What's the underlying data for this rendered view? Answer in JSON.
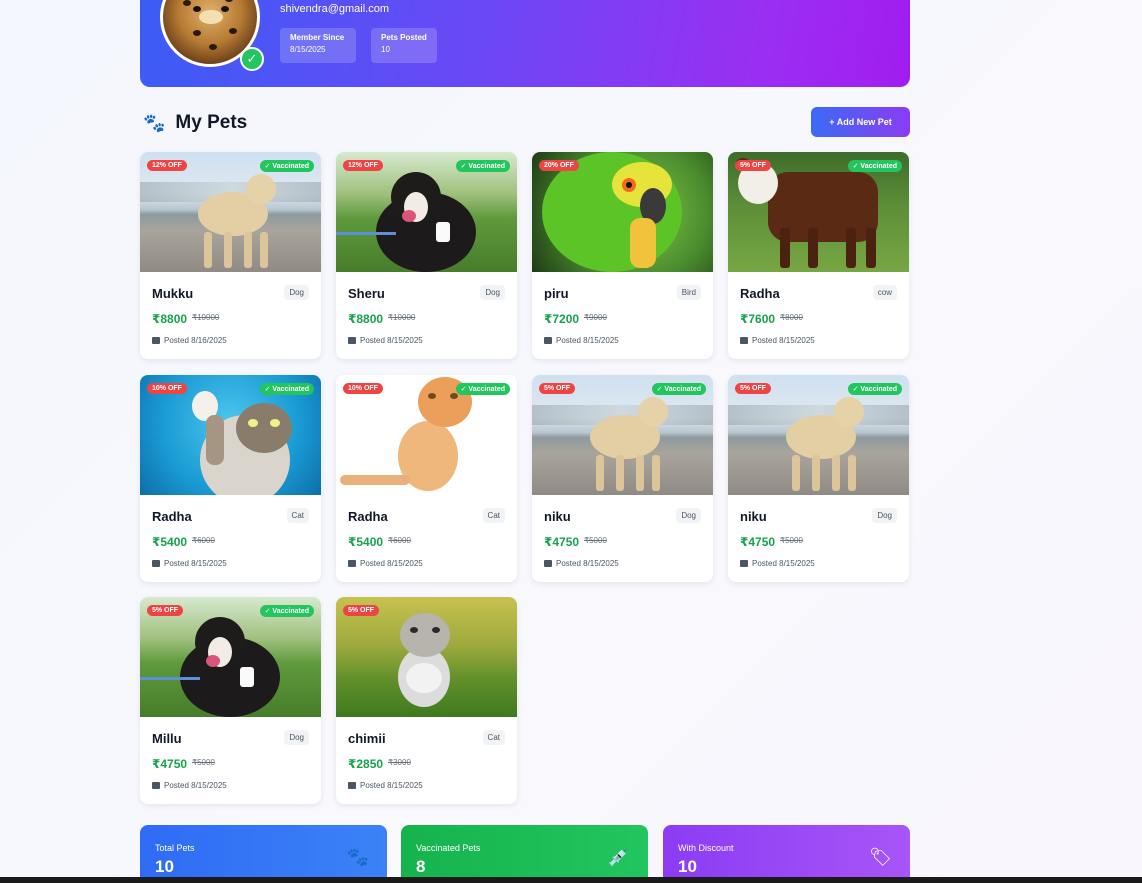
{
  "profile": {
    "email": "shivendra@gmail.com",
    "member_since_label": "Member Since",
    "member_since_value": "8/15/2025",
    "pets_posted_label": "Pets Posted",
    "pets_posted_value": "10"
  },
  "section": {
    "title": "My Pets",
    "add_button": "+ Add New Pet"
  },
  "pets": [
    {
      "name": "Mukku",
      "type": "Dog",
      "discount": "12% OFF",
      "vaccinated": "✓ Vaccinated",
      "price": "₹8800",
      "old_price": "₹10000",
      "posted": "Posted 8/16/2025",
      "scene": "beach-dog"
    },
    {
      "name": "Sheru",
      "type": "Dog",
      "discount": "12% OFF",
      "vaccinated": "✓ Vaccinated",
      "price": "₹8800",
      "old_price": "₹10000",
      "posted": "Posted 8/15/2025",
      "scene": "bernese"
    },
    {
      "name": "piru",
      "type": "Bird",
      "discount": "20% OFF",
      "vaccinated": "",
      "price": "₹7200",
      "old_price": "₹9000",
      "posted": "Posted 8/15/2025",
      "scene": "parrot"
    },
    {
      "name": "Radha",
      "type": "cow",
      "discount": "5% OFF",
      "vaccinated": "✓ Vaccinated",
      "price": "₹7600",
      "old_price": "₹8000",
      "posted": "Posted 8/15/2025",
      "scene": "cow"
    },
    {
      "name": "Radha",
      "type": "Cat",
      "discount": "10% OFF",
      "vaccinated": "✓ Vaccinated",
      "price": "₹5400",
      "old_price": "₹6000",
      "posted": "Posted 8/15/2025",
      "scene": "cat-blue"
    },
    {
      "name": "Radha",
      "type": "Cat",
      "discount": "10% OFF",
      "vaccinated": "✓ Vaccinated",
      "price": "₹5400",
      "old_price": "₹6000",
      "posted": "Posted 8/15/2025",
      "scene": "cat-orange"
    },
    {
      "name": "niku",
      "type": "Dog",
      "discount": "5% OFF",
      "vaccinated": "✓ Vaccinated",
      "price": "₹4750",
      "old_price": "₹5000",
      "posted": "Posted 8/15/2025",
      "scene": "beach-dog"
    },
    {
      "name": "niku",
      "type": "Dog",
      "discount": "5% OFF",
      "vaccinated": "✓ Vaccinated",
      "price": "₹4750",
      "old_price": "₹5000",
      "posted": "Posted 8/15/2025",
      "scene": "beach-dog"
    },
    {
      "name": "Millu",
      "type": "Dog",
      "discount": "5% OFF",
      "vaccinated": "✓ Vaccinated",
      "price": "₹4750",
      "old_price": "₹5000",
      "posted": "Posted 8/15/2025",
      "scene": "bernese"
    },
    {
      "name": "chimii",
      "type": "Cat",
      "discount": "5% OFF",
      "vaccinated": "",
      "price": "₹2850",
      "old_price": "₹3000",
      "posted": "Posted 8/15/2025",
      "scene": "kitten"
    }
  ],
  "stats": [
    {
      "label": "Total Pets",
      "value": "10",
      "icon": "paw-icon",
      "color": "#2f6bf5"
    },
    {
      "label": "Vaccinated Pets",
      "value": "8",
      "icon": "syringe-icon",
      "color": "#16b34d"
    },
    {
      "label": "With Discount",
      "value": "10",
      "icon": "tag-icon",
      "color": "#9b3cf5"
    }
  ],
  "colors": {
    "accent_blue": "#3b5cf6",
    "accent_purple": "#a21cf0",
    "discount_red": "#ef4444",
    "vaccinated_green": "#22c55e",
    "price_green": "#16a34a"
  }
}
